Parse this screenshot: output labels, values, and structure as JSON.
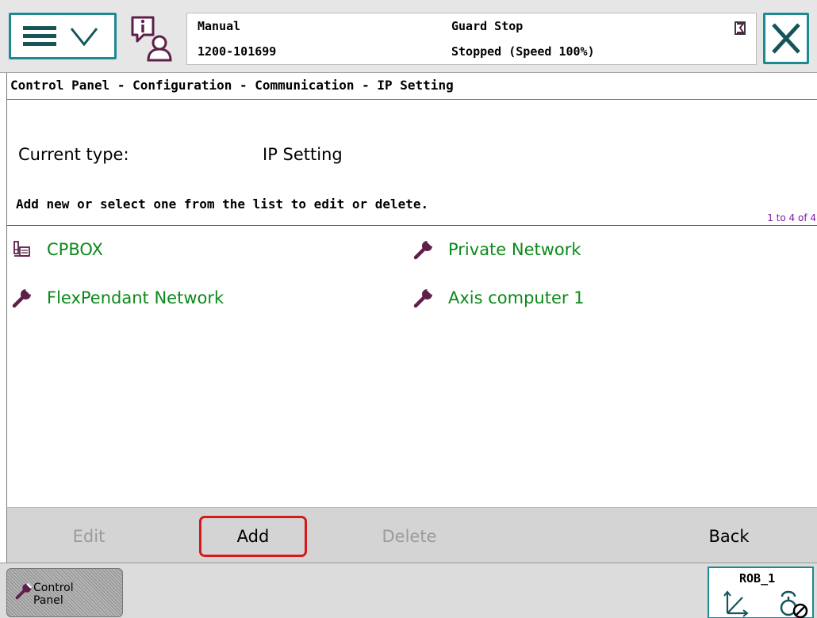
{
  "header": {
    "mode": "Manual",
    "controller_id": "1200-101699",
    "state": "Guard Stop",
    "speed_status": "Stopped (Speed 100%)"
  },
  "breadcrumb": "Control Panel - Configuration - Communication - IP Setting",
  "main": {
    "current_type_label": "Current type:",
    "current_type_value": "IP Setting",
    "instruction": "Add new or select one from the list to edit or delete.",
    "list_count": "1 to 4 of 4",
    "items": [
      {
        "label": "CPBOX",
        "icon": "device-icon"
      },
      {
        "label": "Private Network",
        "icon": "wrench-icon"
      },
      {
        "label": "FlexPendant Network",
        "icon": "wrench-icon"
      },
      {
        "label": "Axis computer 1",
        "icon": "wrench-icon"
      }
    ]
  },
  "actions": {
    "edit": "Edit",
    "add": "Add",
    "delete": "Delete",
    "back": "Back"
  },
  "taskbar": {
    "control_panel": "Control Panel",
    "robot": "ROB_1"
  },
  "colors": {
    "accent": "#1b8a91",
    "list_text": "#0b8a1a",
    "icon": "#5e1f4a",
    "highlight": "#d41a1a"
  }
}
